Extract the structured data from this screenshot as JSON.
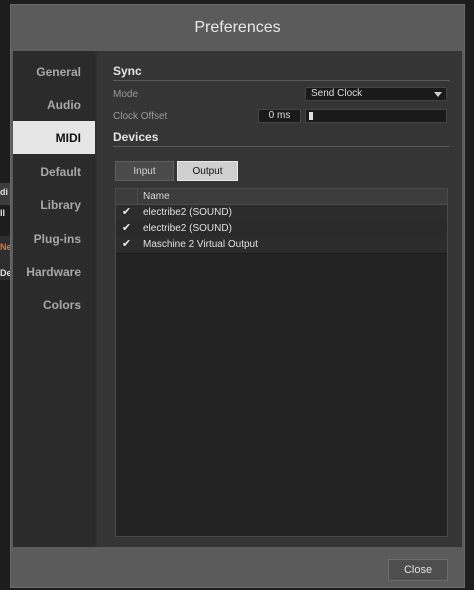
{
  "background": {
    "labels": [
      "di",
      "ll",
      "Ne",
      "De"
    ]
  },
  "dialog": {
    "title": "Preferences",
    "close_label": "Close"
  },
  "sidebar": {
    "items": [
      {
        "label": "General",
        "active": false
      },
      {
        "label": "Audio",
        "active": false
      },
      {
        "label": "MIDI",
        "active": true
      },
      {
        "label": "Default",
        "active": false
      },
      {
        "label": "Library",
        "active": false
      },
      {
        "label": "Plug-ins",
        "active": false
      },
      {
        "label": "Hardware",
        "active": false
      },
      {
        "label": "Colors",
        "active": false
      }
    ]
  },
  "sync": {
    "title": "Sync",
    "mode_label": "Mode",
    "mode_value": "Send Clock",
    "clock_offset_label": "Clock Offset",
    "clock_offset_value": "0 ms"
  },
  "devices": {
    "title": "Devices",
    "tabs": [
      {
        "label": "Input",
        "selected": false
      },
      {
        "label": "Output",
        "selected": true
      }
    ],
    "column_name": "Name",
    "rows": [
      {
        "checked": true,
        "name": "electribe2 (SOUND)"
      },
      {
        "checked": true,
        "name": "electribe2 (SOUND)"
      },
      {
        "checked": true,
        "name": "Maschine 2 Virtual Output"
      }
    ]
  },
  "colors": {
    "active_tab_bg": "#e6e6e6",
    "accent_orange": "#e8742a"
  }
}
